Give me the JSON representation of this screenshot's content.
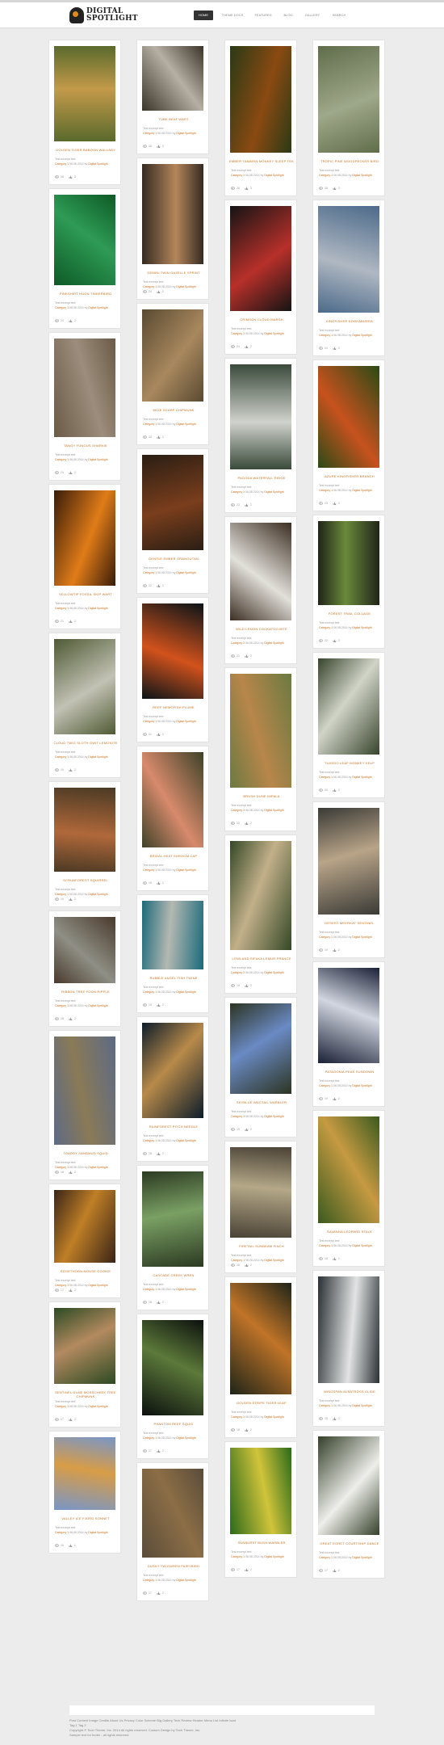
{
  "brand": {
    "line1": "DIGITAL",
    "line2": "SPOTLIGHT"
  },
  "nav": [
    {
      "label": "Home",
      "active": true
    },
    {
      "label": "Theme Docs",
      "active": false
    },
    {
      "label": "Features",
      "active": false
    },
    {
      "label": "Blog",
      "active": false
    },
    {
      "label": "Gallery",
      "active": false
    },
    {
      "label": "Search",
      "active": false
    }
  ],
  "post_meta": {
    "excerpt": "Test excerpt text",
    "category": "Category 1",
    "date": "06.08.2014",
    "by": "by",
    "author": "Digital Spotlight"
  },
  "columns": [
    [
      {
        "title": "Golden Tiger Baboon Wallaby",
        "colors": [
          "#5a6a2c",
          "#c39a4a"
        ],
        "views": "26",
        "likes": "3"
      },
      {
        "title": "Pinkshirt Huon Tinkerbird",
        "colors": [
          "#0d5a26",
          "#2e9b55"
        ],
        "views": "24",
        "likes": "2"
      },
      {
        "title": "Tangy Fungus Sharkie",
        "colors": [
          "#6a5a46",
          "#9c8d7c"
        ],
        "views": "24",
        "likes": "2"
      },
      {
        "title": "Yellowtip Fossil Skip Wart",
        "colors": [
          "#3a1c08",
          "#e07c18"
        ],
        "views": "21",
        "likes": "2"
      },
      {
        "title": "Cloud Twig Sloth Gwit Lemonite",
        "colors": [
          "#4f5a34",
          "#c2c2b4"
        ],
        "views": "19",
        "likes": "2"
      },
      {
        "title": "Scrubforest Squirrel",
        "colors": [
          "#4b3a24",
          "#b0683a"
        ],
        "views": "19",
        "likes": "2"
      },
      {
        "title": "Ribbon Tree Foon Ripple",
        "colors": [
          "#493a2c",
          "#8f8f85"
        ],
        "views": "18",
        "likes": "2"
      },
      {
        "title": "Toaddy Sandmud Squid",
        "colors": [
          "#5d6a86",
          "#8a7a56"
        ],
        "views": "18",
        "likes": "2"
      },
      {
        "title": "Rosethorn Mouse Cookie",
        "colors": [
          "#3a2416",
          "#bf7f26"
        ],
        "views": "17",
        "likes": "2"
      },
      {
        "title": "Sentinel Dune Mosscheek Tree Chipmunk",
        "colors": [
          "#2c4a22",
          "#b48a60"
        ],
        "views": "17",
        "likes": "2"
      },
      {
        "title": "Valley Ice Fjord Sonnet",
        "colors": [
          "#7896c8",
          "#d89c46"
        ],
        "views": "16",
        "likes": "1"
      }
    ],
    [
      {
        "title": "Tube Beat Wart",
        "colors": [
          "#3b3428",
          "#b6b0a4"
        ],
        "views": "26",
        "likes": "3"
      },
      {
        "title": "Gemini Twin Gazelle Sprint",
        "colors": [
          "#352a22",
          "#b4865a"
        ],
        "views": "24",
        "likes": "2"
      },
      {
        "title": "Wide Scarf Chipmunk",
        "colors": [
          "#5a4a32",
          "#a8885e"
        ],
        "views": "24",
        "likes": "2"
      },
      {
        "title": "Gentle Ember Orangutan",
        "colors": [
          "#2a1e14",
          "#7a3e1c"
        ],
        "views": "22",
        "likes": "2"
      },
      {
        "title": "Reef Nemofish Plume",
        "colors": [
          "#0a1418",
          "#d2521c"
        ],
        "views": "21",
        "likes": "2"
      },
      {
        "title": "Bridal Heat Shroom Cap",
        "colors": [
          "#3d4228",
          "#d88a6c"
        ],
        "views": "19",
        "likes": "2"
      },
      {
        "title": "Rubble Angel Fish Twine",
        "colors": [
          "#1a6a7a",
          "#b4b8b2"
        ],
        "views": "19",
        "likes": "2"
      },
      {
        "title": "Rainforest Pitch Needle",
        "colors": [
          "#0d1c2a",
          "#b88a4a"
        ],
        "views": "18",
        "likes": "2"
      },
      {
        "title": "Cascade Creek Wren",
        "colors": [
          "#2c3a22",
          "#7aa064"
        ],
        "views": "18",
        "likes": "2"
      },
      {
        "title": "Phantom Reef Squid",
        "colors": [
          "#0c100e",
          "#5c7a3a"
        ],
        "views": "17",
        "likes": "2"
      },
      {
        "title": "Dusky Twigwren Fairybird",
        "colors": [
          "#5a4c3a",
          "#8c6e46"
        ],
        "views": "17",
        "likes": "2"
      }
    ],
    [
      {
        "title": "Ember Tamarin Monkey Sleep Tek",
        "colors": [
          "#2a3a16",
          "#8a4a12"
        ],
        "views": "26",
        "likes": "3"
      },
      {
        "title": "Crimson Cloud Marsh",
        "colors": [
          "#141414",
          "#b8302a"
        ],
        "views": "24",
        "likes": "2"
      },
      {
        "title": "Pagoda Waterfall Ridge",
        "colors": [
          "#394a3a",
          "#d0d2cc"
        ],
        "views": "23",
        "likes": "2"
      },
      {
        "title": "Wild Lemon Cockatoo Bite",
        "colors": [
          "#3c2e22",
          "#e2e0da"
        ],
        "views": "21",
        "likes": "2"
      },
      {
        "title": "Brush Dune Impala",
        "colors": [
          "#6b7a42",
          "#b8864a"
        ],
        "views": "20",
        "likes": "2"
      },
      {
        "title": "Lowland Sifaka Lemur Prance",
        "colors": [
          "#354826",
          "#c2b08a"
        ],
        "views": "19",
        "likes": "2"
      },
      {
        "title": "Skyblue Wagtail Warbler",
        "colors": [
          "#2c3422",
          "#6a8ac4"
        ],
        "views": "19",
        "likes": "2"
      },
      {
        "title": "Firetail Sunbeam Finch",
        "colors": [
          "#4a4236",
          "#b4a888"
        ],
        "views": "18",
        "likes": "2"
      },
      {
        "title": "Golden Stripe Tiger Leap",
        "colors": [
          "#1e2418",
          "#c07428"
        ],
        "views": "18",
        "likes": "2"
      },
      {
        "title": "Sunburst Bush Warbler",
        "colors": [
          "#2b6a1a",
          "#d0c43a"
        ],
        "views": "17",
        "likes": "2"
      }
    ],
    [
      {
        "title": "Tropic Pine Woodpecker Bird",
        "colors": [
          "#606d4a",
          "#9ea88a"
        ],
        "views": "26",
        "likes": "3"
      },
      {
        "title": "Kingfisher Kookaburra",
        "colors": [
          "#4c6a8a",
          "#b0b8c2"
        ],
        "views": "24",
        "likes": "2"
      },
      {
        "title": "Azure Kingfisher Branch",
        "colors": [
          "#2b4a16",
          "#c7521e"
        ],
        "views": "23",
        "likes": "2"
      },
      {
        "title": "Forest Trail Collage",
        "colors": [
          "#202418",
          "#6a8a3a"
        ],
        "views": "22",
        "likes": "2"
      },
      {
        "title": "Tuxedo Leaf Monkey Kelp",
        "colors": [
          "#38442c",
          "#d0d4c8"
        ],
        "views": "20",
        "likes": "2"
      },
      {
        "title": "Desert Meerkat Sentinel",
        "colors": [
          "#3a3a36",
          "#b8a488"
        ],
        "views": "19",
        "likes": "2"
      },
      {
        "title": "Patagonia Peak Sundown",
        "colors": [
          "#1a2036",
          "#d2d6e0"
        ],
        "views": "19",
        "likes": "2"
      },
      {
        "title": "Savanna Leopard Stalk",
        "colors": [
          "#3a5a1e",
          "#c69a42"
        ],
        "views": "18",
        "likes": "2"
      },
      {
        "title": "Wingspan Albatross Glide",
        "colors": [
          "#2a3034",
          "#e2e4e4"
        ],
        "views": "18",
        "likes": "2"
      },
      {
        "title": "Great Egret Courtship Dance",
        "colors": [
          "#34402a",
          "#eeeeea"
        ],
        "views": "17",
        "likes": "2"
      }
    ]
  ],
  "footer": {
    "links": "Post Content  Image Credits  About Us  Privacy  Color Scheme  Big Gallery  Tech Review  Header Menu List  Infinite load",
    "tags": "Tag 1  Tag 2",
    "copyright": "Copyright © Tech Theme, Inc. 2014 All rights reserved. Custom Design by Tech Theme, Inc.",
    "note": "Sample text for footer - all rights reserved."
  }
}
